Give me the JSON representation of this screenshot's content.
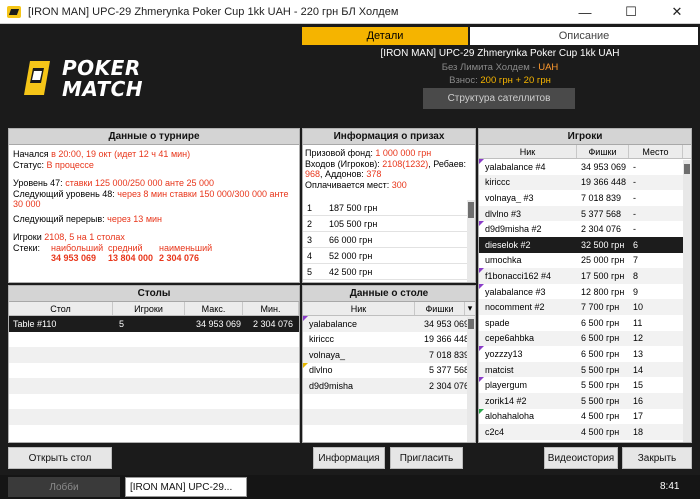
{
  "window": {
    "title": "[IRON MAN] UPC-29 Zhmerynka Poker Cup 1kk UAH - 220 грн БЛ Холдем",
    "minimize": "—",
    "maximize": "☐",
    "close": "✕"
  },
  "tabs": {
    "details": "Детали",
    "description": "Описание"
  },
  "logo": {
    "line1": "POKER",
    "line2": "MATCH"
  },
  "header": {
    "name": "[IRON MAN] UPC-29 Zhmerynka Poker Cup 1kk UAH",
    "game_label": "Без Лимита Холдем - ",
    "game_currency": "UAH",
    "fee_label": "Взнос: ",
    "fee_value": "200 грн + 20 грн",
    "satellites_button": "Структура сателлитов"
  },
  "tournament": {
    "title": "Данные о турнире",
    "started_label": "Начался ",
    "started_value": "в 20:00, 19 окт (идет 12 ч 41 мин)",
    "status_label": "Статус: ",
    "status_value": "В процессе",
    "level_label": "Уровень 47: ",
    "level_value": "ставки 125 000/250 000 анте 25 000",
    "next_level_label": "Следующий уровень 48: ",
    "next_level_value": "через 8 мин ставки 150 000/300 000 анте 30 000",
    "break_label": "Следующий перерыв: ",
    "break_value": "через 13 мин",
    "players_label": "Игроки ",
    "players_value": "2108, 5 на 1 столах",
    "stacks_label": "Стеки:",
    "stack_headers": [
      "наибольший",
      "средний",
      "наименьший"
    ],
    "stack_values": [
      "34 953 069",
      "13 804 000",
      "2 304 076"
    ]
  },
  "prizes": {
    "title": "Информация о призах",
    "fund_label": "Призовой фонд: ",
    "fund_value": "1 000 000 грн",
    "entries_label": "Входов (Игроков): ",
    "entries_value": "2108(1232)",
    "rebuys_label": ", Ребаев:",
    "rebuys_value": "968",
    "addons_label": ", Аддонов: ",
    "addons_value": "378",
    "paid_label": "Оплачивается мест: ",
    "paid_value": "300",
    "list": [
      {
        "rank": "1",
        "amount": "187 500 грн"
      },
      {
        "rank": "2",
        "amount": "105 500 грн"
      },
      {
        "rank": "3",
        "amount": "66 000 грн"
      },
      {
        "rank": "4",
        "amount": "52 000 грн"
      },
      {
        "rank": "5",
        "amount": "42 500 грн"
      }
    ]
  },
  "players": {
    "title": "Игроки",
    "columns": [
      "Ник",
      "Фишки",
      "Место"
    ],
    "rows": [
      {
        "nick": "yalabalance #4",
        "chips": "34 953 069",
        "place": "-",
        "flag": "purple"
      },
      {
        "nick": "kiriccc",
        "chips": "19 366 448",
        "place": "-",
        "flag": ""
      },
      {
        "nick": "volnaya_ #3",
        "chips": "7 018 839",
        "place": "-",
        "flag": ""
      },
      {
        "nick": "dlvlno #3",
        "chips": "5 377 568",
        "place": "-",
        "flag": ""
      },
      {
        "nick": "d9d9misha #2",
        "chips": "2 304 076",
        "place": "-",
        "flag": "purple"
      },
      {
        "nick": "dieselok #2",
        "chips": "32 500 грн",
        "place": "6",
        "flag": ""
      },
      {
        "nick": "umochka",
        "chips": "25 000 грн",
        "place": "7",
        "flag": ""
      },
      {
        "nick": "f1bonacci162 #4",
        "chips": "17 500 грн",
        "place": "8",
        "flag": "purple"
      },
      {
        "nick": "yalabalance #3",
        "chips": "12 800 грн",
        "place": "9",
        "flag": "purple"
      },
      {
        "nick": "nocomment #2",
        "chips": "7 700 грн",
        "place": "10",
        "flag": ""
      },
      {
        "nick": "spade",
        "chips": "6 500 грн",
        "place": "11",
        "flag": ""
      },
      {
        "nick": "cepe6ahbka",
        "chips": "6 500 грн",
        "place": "12",
        "flag": ""
      },
      {
        "nick": "yozzzy13",
        "chips": "6 500 грн",
        "place": "13",
        "flag": "purple"
      },
      {
        "nick": "matcist",
        "chips": "5 500 грн",
        "place": "14",
        "flag": ""
      },
      {
        "nick": "playergum",
        "chips": "5 500 грн",
        "place": "15",
        "flag": "purple"
      },
      {
        "nick": "zorik14 #2",
        "chips": "5 500 грн",
        "place": "16",
        "flag": ""
      },
      {
        "nick": "alohahaloha",
        "chips": "4 500 грн",
        "place": "17",
        "flag": "green"
      },
      {
        "nick": "c2c4",
        "chips": "4 500 грн",
        "place": "18",
        "flag": ""
      }
    ]
  },
  "tables": {
    "title": "Столы",
    "columns": [
      "Стол",
      "Игроки",
      "Макс.",
      "Мин."
    ],
    "rows": [
      {
        "name": "Table #110",
        "players": "5",
        "max": "34 953 069",
        "min": "2 304 076"
      }
    ]
  },
  "table_data": {
    "title": "Данные о столе",
    "columns": [
      "Ник",
      "Фишки"
    ],
    "rows": [
      {
        "nick": "yalabalance",
        "chips": "34 953 069",
        "flag": "purple"
      },
      {
        "nick": "kiriccc",
        "chips": "19 366 448",
        "flag": ""
      },
      {
        "nick": "volnaya_",
        "chips": "7 018 839",
        "flag": ""
      },
      {
        "nick": "dlvlno",
        "chips": "5 377 568",
        "flag": "yellow"
      },
      {
        "nick": "d9d9misha",
        "chips": "2 304 076",
        "flag": ""
      }
    ]
  },
  "buttons": {
    "open_table": "Открыть стол",
    "info": "Информация",
    "invite": "Пригласить",
    "video": "Видеоистория",
    "close": "Закрыть"
  },
  "taskbar": {
    "lobby": "Лобби",
    "tab": "[IRON MAN] UPC-29...",
    "clock": "8:41"
  },
  "colors": {
    "accent": "#f5b400",
    "highlight_red": "#e8361b",
    "selected_row": "#1c1c1c"
  }
}
